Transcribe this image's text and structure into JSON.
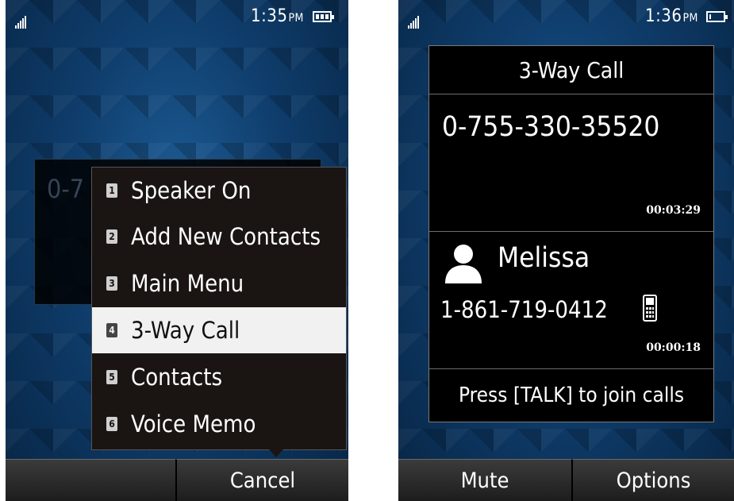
{
  "left_screen": {
    "status": {
      "time": "1:35",
      "ampm": "PM"
    },
    "background_number": "0-7",
    "menu": {
      "items": [
        {
          "num": "1",
          "label": "Speaker On"
        },
        {
          "num": "2",
          "label": "Add New Contacts"
        },
        {
          "num": "3",
          "label": "Main Menu"
        },
        {
          "num": "4",
          "label": "3-Way Call"
        },
        {
          "num": "5",
          "label": "Contacts"
        },
        {
          "num": "6",
          "label": "Voice Memo"
        }
      ],
      "selected_index": 3
    },
    "softkeys": {
      "left": "",
      "right": "Cancel"
    }
  },
  "right_screen": {
    "status": {
      "time": "1:36",
      "ampm": "PM"
    },
    "title": "3-Way Call",
    "first_call": {
      "number": "0-755-330-35520",
      "timer": "00:03:29"
    },
    "second_call": {
      "name": "Melissa",
      "number": "1-861-719-0412",
      "timer": "00:00:18"
    },
    "hint": "Press [TALK] to join calls",
    "softkeys": {
      "left": "Mute",
      "right": "Options"
    }
  },
  "colors": {
    "wallpaper": "#0f3d6c",
    "menu_bg": "#1a1412",
    "highlight": "#f1f1f1",
    "panel_bg": "#000000"
  },
  "icons": [
    "signal-icon",
    "battery-icon",
    "contact-avatar-icon",
    "mobile-phone-icon"
  ]
}
